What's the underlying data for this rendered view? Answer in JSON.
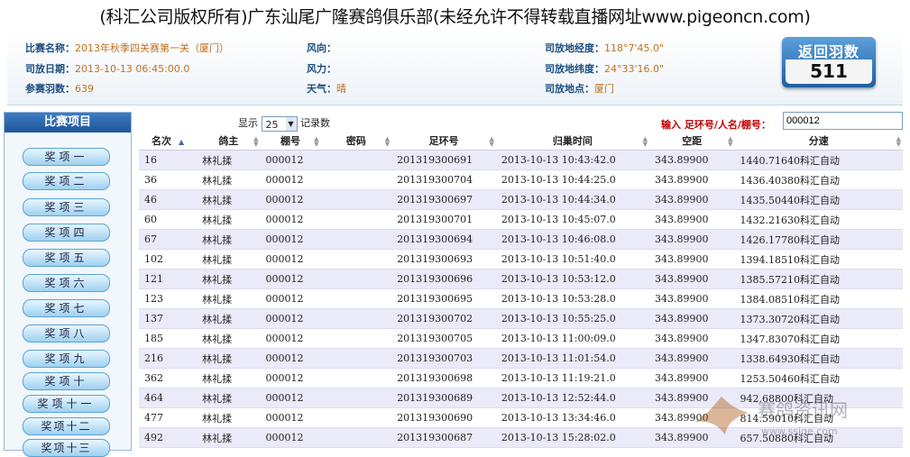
{
  "page_title": "(科汇公司版权所有)广东汕尾广隆赛鸽俱乐部(未经允许不得转载直播网址www.pigeoncn.com)",
  "info": {
    "race_name_label": "比赛名称：",
    "race_name": "2013年秋季四关赛第一关（厦门）",
    "release_date_label": "司放日期：",
    "release_date": "2013-10-13 06:45:00.0",
    "entries_label": "参赛羽数：",
    "entries": "639",
    "wind_dir_label": "风向：",
    "wind_dir": "",
    "wind_force_label": "风力：",
    "wind_force": "",
    "weather_label": "天气：",
    "weather": "晴",
    "longitude_label": "司放地经度：",
    "longitude": "118°7'45.0\"",
    "latitude_label": "司放地纬度：",
    "latitude": "24°33'16.0\"",
    "location_label": "司放地点：",
    "location": "厦门"
  },
  "back_button": {
    "label": "返回羽数",
    "count": "511"
  },
  "sidebar": {
    "title": "比赛项目",
    "items": [
      "奖项一",
      "奖项二",
      "奖项三",
      "奖项四",
      "奖项五",
      "奖项六",
      "奖项七",
      "奖项八",
      "奖项九",
      "奖项十",
      "奖项十一",
      "奖项十二",
      "奖项十三"
    ]
  },
  "controls": {
    "show_label": "显示",
    "page_size": "25",
    "records_label": "记录数",
    "search_label": "输入 足环号/人名/棚号：",
    "search_value": "000012"
  },
  "table": {
    "columns": [
      "名次",
      "鸽主",
      "棚号",
      "密码",
      "足环号",
      "归巢时间",
      "空距",
      "分速"
    ],
    "rows": [
      [
        "16",
        "林礼揉",
        "000012",
        "",
        "201319300691",
        "2013-10-13 10:43:42.0",
        "343.89900",
        "1440.71640科汇自动"
      ],
      [
        "36",
        "林礼揉",
        "000012",
        "",
        "201319300704",
        "2013-10-13 10:44:25.0",
        "343.89900",
        "1436.40380科汇自动"
      ],
      [
        "46",
        "林礼揉",
        "000012",
        "",
        "201319300697",
        "2013-10-13 10:44:34.0",
        "343.89900",
        "1435.50440科汇自动"
      ],
      [
        "60",
        "林礼揉",
        "000012",
        "",
        "201319300701",
        "2013-10-13 10:45:07.0",
        "343.89900",
        "1432.21630科汇自动"
      ],
      [
        "67",
        "林礼揉",
        "000012",
        "",
        "201319300694",
        "2013-10-13 10:46:08.0",
        "343.89900",
        "1426.17780科汇自动"
      ],
      [
        "102",
        "林礼揉",
        "000012",
        "",
        "201319300693",
        "2013-10-13 10:51:40.0",
        "343.89900",
        "1394.18510科汇自动"
      ],
      [
        "121",
        "林礼揉",
        "000012",
        "",
        "201319300696",
        "2013-10-13 10:53:12.0",
        "343.89900",
        "1385.57210科汇自动"
      ],
      [
        "123",
        "林礼揉",
        "000012",
        "",
        "201319300695",
        "2013-10-13 10:53:28.0",
        "343.89900",
        "1384.08510科汇自动"
      ],
      [
        "137",
        "林礼揉",
        "000012",
        "",
        "201319300702",
        "2013-10-13 10:55:25.0",
        "343.89900",
        "1373.30720科汇自动"
      ],
      [
        "185",
        "林礼揉",
        "000012",
        "",
        "201319300705",
        "2013-10-13 11:00:09.0",
        "343.89900",
        "1347.83070科汇自动"
      ],
      [
        "216",
        "林礼揉",
        "000012",
        "",
        "201319300703",
        "2013-10-13 11:01:54.0",
        "343.89900",
        "1338.64930科汇自动"
      ],
      [
        "362",
        "林礼揉",
        "000012",
        "",
        "201319300698",
        "2013-10-13 11:19:21.0",
        "343.89900",
        "1253.50460科汇自动"
      ],
      [
        "464",
        "林礼揉",
        "000012",
        "",
        "201319300689",
        "2013-10-13 12:52:44.0",
        "343.89900",
        "942.68800科汇自动"
      ],
      [
        "477",
        "林礼揉",
        "000012",
        "",
        "201319300690",
        "2013-10-13 13:34:46.0",
        "343.89900",
        "814.59010科汇自动"
      ],
      [
        "492",
        "林礼揉",
        "000012",
        "",
        "201319300687",
        "2013-10-13 15:28:02.0",
        "343.89900",
        "657.50880科汇自动"
      ]
    ]
  },
  "watermark": {
    "text": "赛鸽资讯网",
    "url": "www.ssige.com"
  }
}
